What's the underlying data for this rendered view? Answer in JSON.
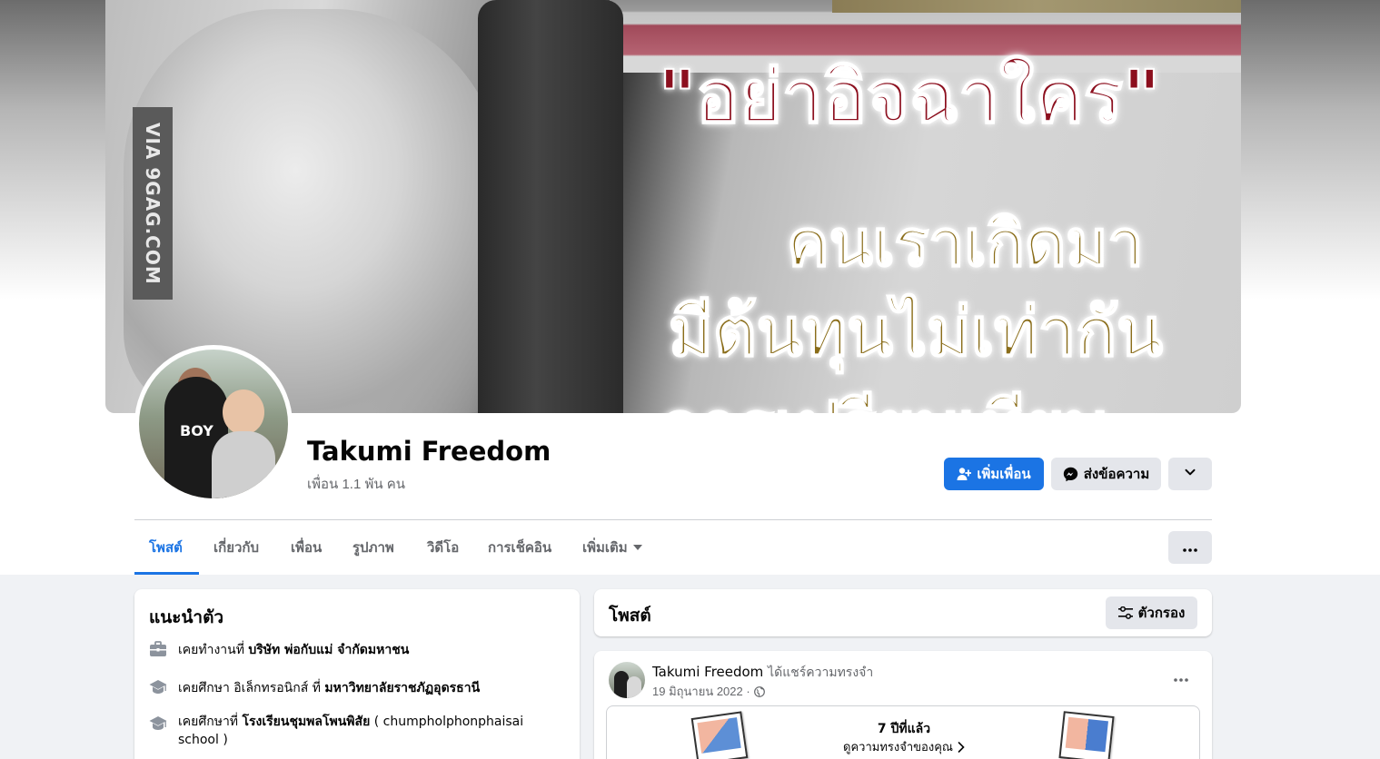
{
  "cover": {
    "watermark": "VIA 9GAG.COM",
    "quote": "\"อย่าอิจฉาใคร\"",
    "line1": "คนเราเกิดมา",
    "line2": "มีต้นทุนไม่เท่ากัน",
    "line3": "การเปรียบเทียบ"
  },
  "profile": {
    "name": "Takumi Freedom",
    "friends": "เพื่อน 1.1 พัน คน",
    "avatar_text": "BOY"
  },
  "actions": {
    "add_friend": "เพิ่มเพื่อน",
    "message": "ส่งข้อความ"
  },
  "tabs": [
    {
      "label": "โพสต์",
      "active": true
    },
    {
      "label": "เกี่ยวกับ"
    },
    {
      "label": "เพื่อน"
    },
    {
      "label": "รูปภาพ"
    },
    {
      "label": "วิดีโอ"
    },
    {
      "label": "การเช็คอิน"
    },
    {
      "label": "เพิ่มเติม"
    }
  ],
  "intro": {
    "title": "แนะนำตัว",
    "items": [
      {
        "icon": "briefcase-icon",
        "prefix": "เคยทำงานที่ ",
        "bold": "บริษัท พ่อกับแม่ จำกัดมหาชน",
        "suffix": ""
      },
      {
        "icon": "graduation-cap-icon",
        "prefix": "เคยศึกษา อิเล็กทรอนิกส์ ที่ ",
        "bold": "มหาวิทยาลัยราชภัฏอุดรธานี",
        "suffix": ""
      },
      {
        "icon": "graduation-cap-icon",
        "prefix": "เคยศึกษาที่ ",
        "bold": "โรงเรียนชุมพลโพนพิสัย",
        "suffix": " ( chumpholphonphaisai school )"
      }
    ]
  },
  "posts_header": {
    "title": "โพสต์",
    "filter": "ตัวกรอง"
  },
  "post": {
    "author": "Takumi Freedom",
    "action": "ได้แชร์ความทรงจำ",
    "date": "19 มิถุนายน 2022 ·",
    "memory_years": "7 ปีที่แล้ว",
    "memory_link": "ดูความทรงจำของคุณ"
  },
  "colors": {
    "primary": "#1b74e4",
    "background": "#f0f2f5",
    "secondary_text": "#65676b"
  }
}
